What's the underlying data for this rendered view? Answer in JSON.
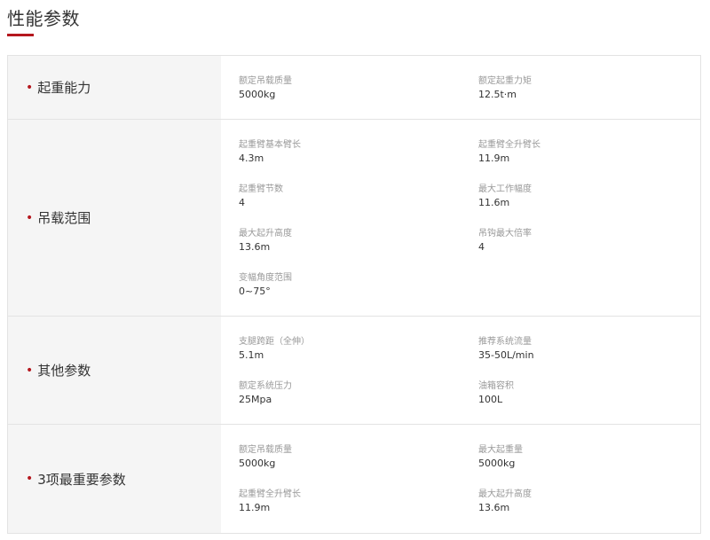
{
  "section": {
    "title": "性能参数"
  },
  "colors": {
    "accent": "#b5171e",
    "label_bg": "#f5f5f5",
    "border": "#e3e3e3",
    "muted_text": "#999999"
  },
  "groups": [
    {
      "label": "起重能力",
      "params": [
        {
          "name": "额定吊载质量",
          "value": "5000kg"
        },
        {
          "name": "额定起重力矩",
          "value": "12.5t·m"
        }
      ]
    },
    {
      "label": "吊载范围",
      "params": [
        {
          "name": "起重臂基本臂长",
          "value": "4.3m"
        },
        {
          "name": "起重臂全升臂长",
          "value": "11.9m"
        },
        {
          "name": "起重臂节数",
          "value": "4"
        },
        {
          "name": "最大工作幅度",
          "value": "11.6m"
        },
        {
          "name": "最大起升高度",
          "value": "13.6m"
        },
        {
          "name": "吊钩最大倍率",
          "value": "4"
        },
        {
          "name": "变幅角度范围",
          "value": "0~75°"
        }
      ]
    },
    {
      "label": "其他参数",
      "params": [
        {
          "name": "支腿跨距（全伸）",
          "value": "5.1m"
        },
        {
          "name": "推荐系统流量",
          "value": "35-50L/min"
        },
        {
          "name": "额定系统压力",
          "value": "25Mpa"
        },
        {
          "name": "油箱容积",
          "value": "100L"
        }
      ]
    },
    {
      "label": "3项最重要参数",
      "params": [
        {
          "name": "额定吊载质量",
          "value": "5000kg"
        },
        {
          "name": "最大起重量",
          "value": "5000kg"
        },
        {
          "name": "起重臂全升臂长",
          "value": "11.9m"
        },
        {
          "name": "最大起升高度",
          "value": "13.6m"
        }
      ]
    }
  ]
}
